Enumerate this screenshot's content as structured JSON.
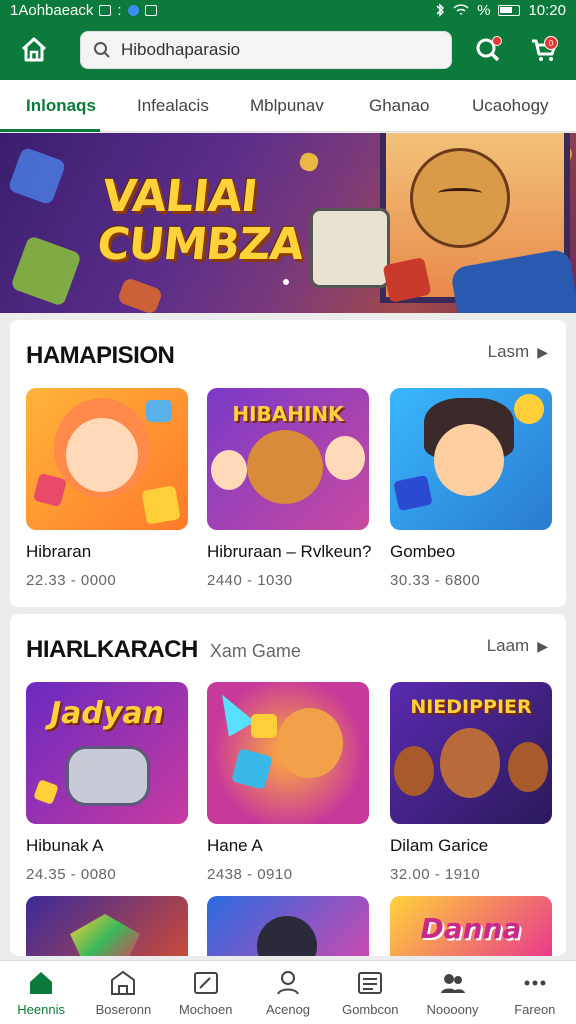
{
  "status_bar": {
    "left_text": "1Aohbaeack",
    "time": "10:20",
    "signal_text": "%"
  },
  "header": {
    "search_value": "Hibodhaparasio",
    "cart_badge": "0"
  },
  "tabs": [
    {
      "label": "Inlonaqs",
      "active": true
    },
    {
      "label": "Infealacis",
      "active": false
    },
    {
      "label": "Mblpunav",
      "active": false
    },
    {
      "label": "Ghanao",
      "active": false
    },
    {
      "label": "Ucaohogy",
      "active": false
    }
  ],
  "banner": {
    "title_line1": "VALIAI",
    "title_line2": "CUMBZA"
  },
  "sections": [
    {
      "title": "HAMAPISION",
      "subtitle": "",
      "more_label": "Lasm",
      "games": [
        {
          "title": "Hibraran",
          "meta": "22.33 - 0000"
        },
        {
          "title": "Hibruraan – Rvlkeun?",
          "meta": "2440 - 1030",
          "thumb_text": "HIBAHINK"
        },
        {
          "title": "Gombeo",
          "meta": "30.33 - 6800"
        }
      ]
    },
    {
      "title": "HIARLKARACH",
      "subtitle": "Xam Game",
      "more_label": "Laam",
      "games": [
        {
          "title": "Hibunak A",
          "meta": "24.35 - 0080",
          "thumb_text": "Jadyan"
        },
        {
          "title": "Hane A",
          "meta": "2438 - 0910"
        },
        {
          "title": "Dilam Garice",
          "meta": "32.00 - 1910",
          "thumb_text": "NIEDIPPIER"
        }
      ]
    }
  ],
  "partial_row": {
    "thumb3_text": "Danna"
  },
  "bottom_nav": [
    {
      "label": "Heennis",
      "icon": "home-icon",
      "active": true
    },
    {
      "label": "Boseronn",
      "icon": "store-icon",
      "active": false
    },
    {
      "label": "Mochoen",
      "icon": "edit-icon",
      "active": false
    },
    {
      "label": "Acenog",
      "icon": "user-icon",
      "active": false
    },
    {
      "label": "Gombcon",
      "icon": "list-icon",
      "active": false
    },
    {
      "label": "Noooony",
      "icon": "group-icon",
      "active": false
    },
    {
      "label": "Fareon",
      "icon": "more-icon",
      "active": false
    }
  ],
  "colors": {
    "brand_green": "#0b7a3a",
    "badge_red": "#e53935"
  }
}
